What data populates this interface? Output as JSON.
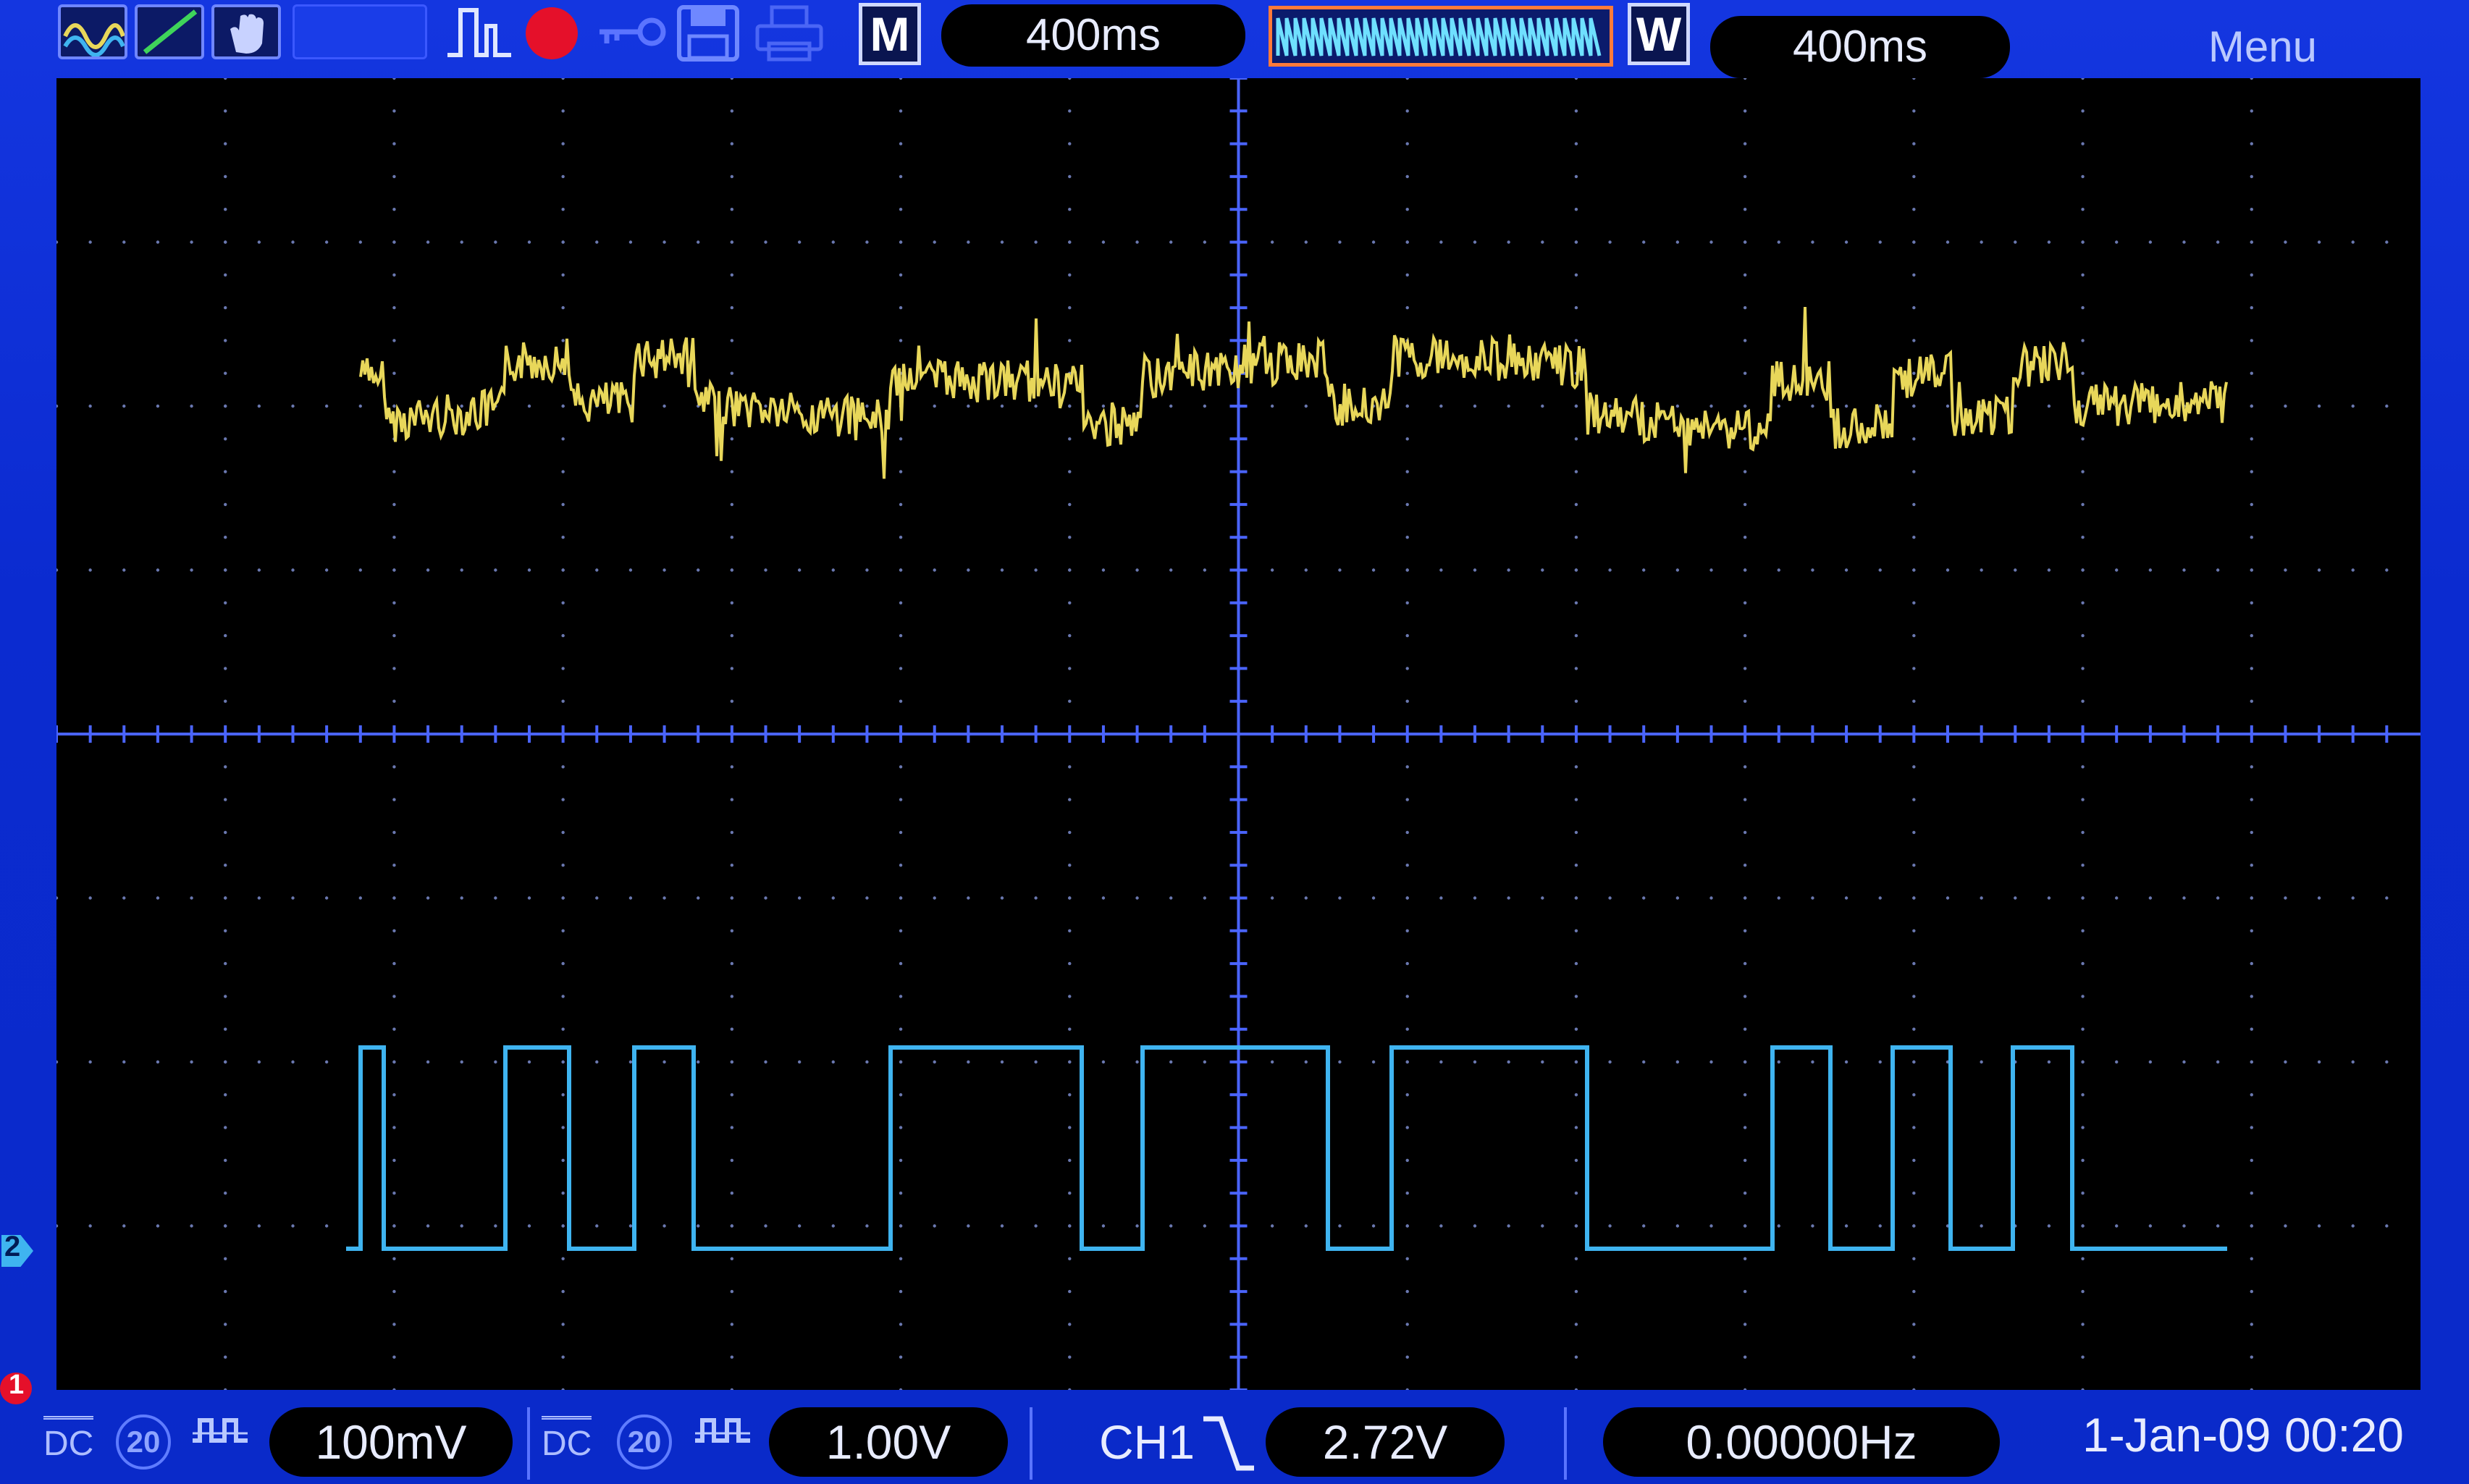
{
  "toolbar": {
    "mode_badge": "M",
    "main_timebase": "400ms",
    "window_badge": "W",
    "window_timebase": "400ms",
    "menu_label": "Menu"
  },
  "bottom_bar": {
    "ch1_coupling": "DC",
    "ch1_bw_limit": "20",
    "ch1_scale": "100mV",
    "ch2_coupling": "DC",
    "ch2_bw_limit": "20",
    "ch2_scale": "1.00V",
    "trigger_source": "CH1",
    "trigger_level": "2.72V",
    "frequency": "0.00000Hz",
    "datetime": "1-Jan-09 00:20"
  },
  "markers": {
    "ch2_marker": "2",
    "ch1_marker": "1"
  },
  "colors": {
    "ch1": "#e8d75a",
    "ch2": "#3fb4f0",
    "grid": "#4a64ff",
    "bezel": "#0b2bd0",
    "record": "#e5102a"
  },
  "icons": [
    "channel-sine-icon",
    "trigger-slope-icon",
    "hand-icon",
    "pulse-icon",
    "record-icon",
    "key-icon",
    "save-icon",
    "print-icon"
  ]
}
